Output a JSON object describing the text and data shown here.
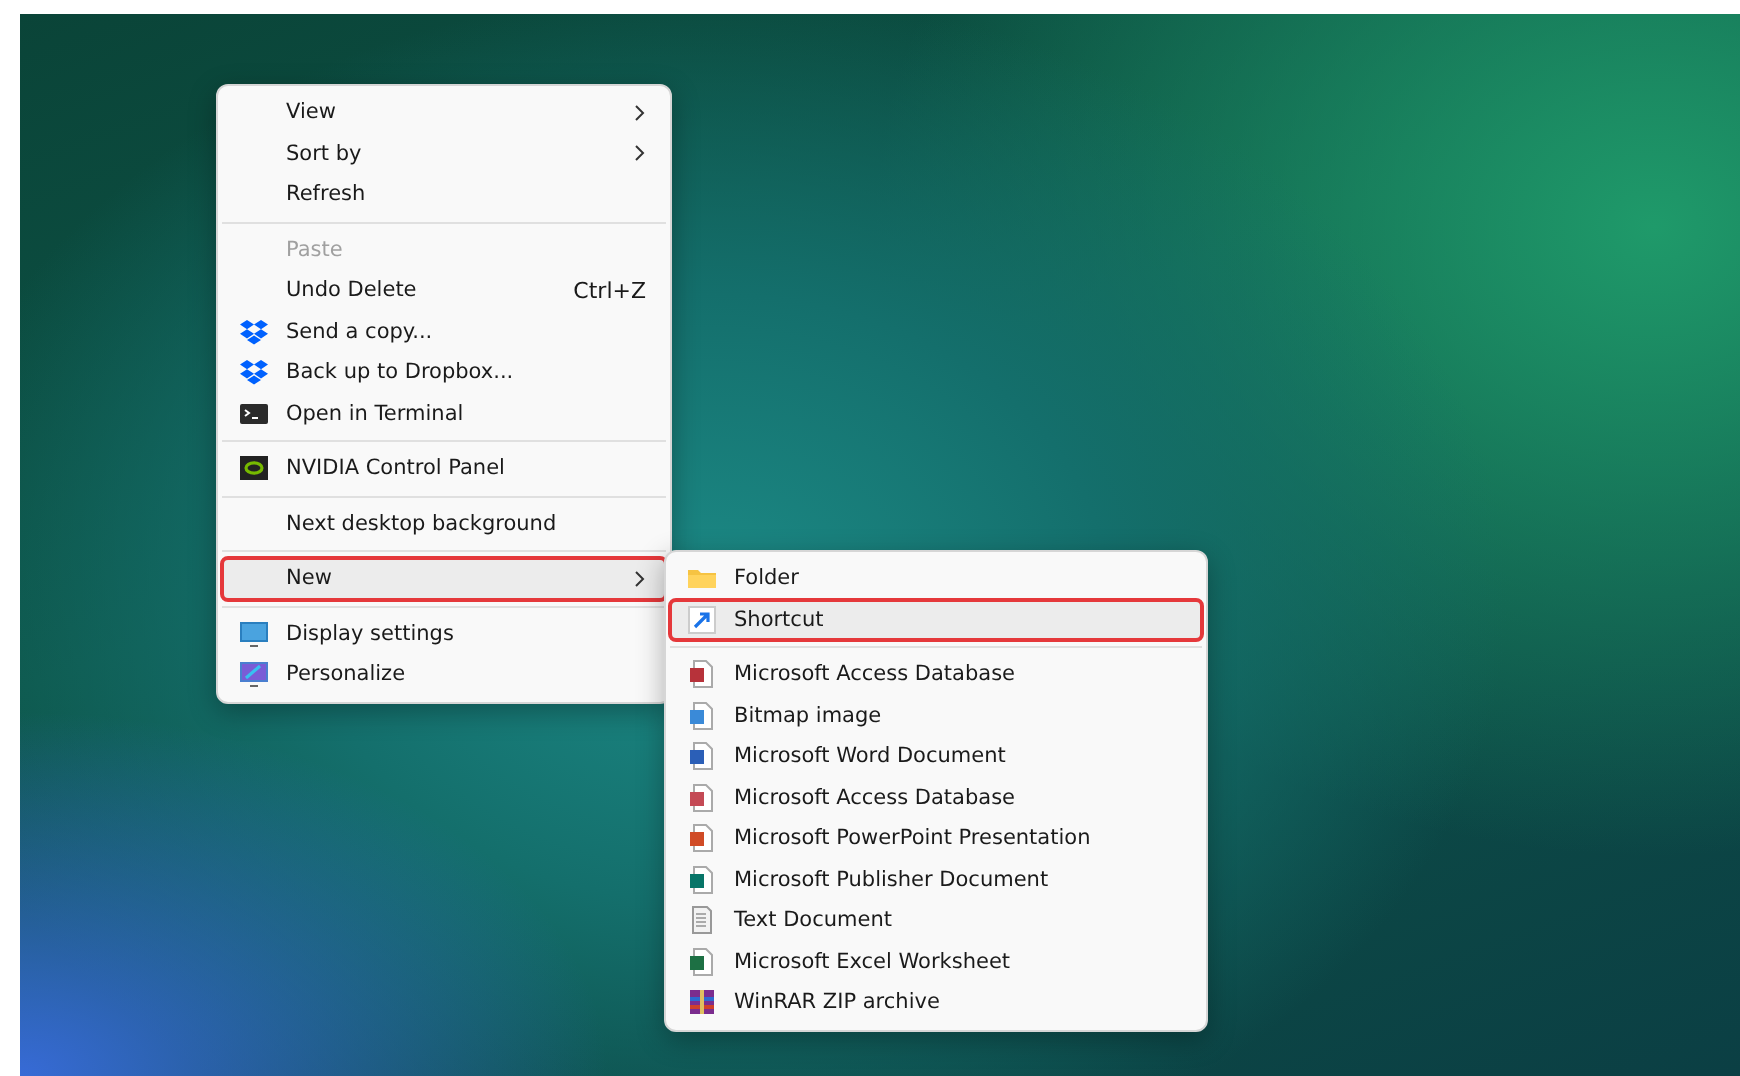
{
  "context_menu": {
    "items": [
      {
        "kind": "item",
        "label": "View",
        "submenu": true,
        "selected": false
      },
      {
        "kind": "item",
        "label": "Sort by",
        "submenu": true,
        "selected": false
      },
      {
        "kind": "item",
        "label": "Refresh",
        "selected": false
      },
      {
        "kind": "separator"
      },
      {
        "kind": "item",
        "label": "Paste",
        "disabled": true,
        "selected": false
      },
      {
        "kind": "item",
        "label": "Undo Delete",
        "shortcut": "Ctrl+Z",
        "selected": false
      },
      {
        "kind": "item",
        "label": "Send a copy...",
        "selected": false
      },
      {
        "kind": "item",
        "label": "Back up to Dropbox...",
        "selected": false
      },
      {
        "kind": "item",
        "label": "Open in Terminal",
        "selected": false
      },
      {
        "kind": "separator"
      },
      {
        "kind": "item",
        "label": "NVIDIA Control Panel",
        "selected": false
      },
      {
        "kind": "separator"
      },
      {
        "kind": "item",
        "label": "Next desktop background",
        "selected": false
      },
      {
        "kind": "separator"
      },
      {
        "kind": "item",
        "label": "New",
        "submenu": true,
        "selected": true
      },
      {
        "kind": "separator"
      },
      {
        "kind": "item",
        "label": "Display settings",
        "selected": false
      },
      {
        "kind": "item",
        "label": "Personalize",
        "selected": false
      }
    ]
  },
  "new_submenu": {
    "items": [
      {
        "kind": "item",
        "label": "Folder",
        "selected": false
      },
      {
        "kind": "item",
        "label": "Shortcut",
        "selected": true
      },
      {
        "kind": "separator"
      },
      {
        "kind": "item",
        "label": "Microsoft Access Database",
        "selected": false
      },
      {
        "kind": "item",
        "label": "Bitmap image",
        "selected": false
      },
      {
        "kind": "item",
        "label": "Microsoft Word Document",
        "selected": false
      },
      {
        "kind": "item",
        "label": "Microsoft Access Database",
        "selected": false
      },
      {
        "kind": "item",
        "label": "Microsoft PowerPoint Presentation",
        "selected": false
      },
      {
        "kind": "item",
        "label": "Microsoft Publisher Document",
        "selected": false
      },
      {
        "kind": "item",
        "label": "Text Document",
        "selected": false
      },
      {
        "kind": "item",
        "label": "Microsoft Excel Worksheet",
        "selected": false
      },
      {
        "kind": "item",
        "label": "WinRAR ZIP archive",
        "selected": false
      }
    ]
  }
}
